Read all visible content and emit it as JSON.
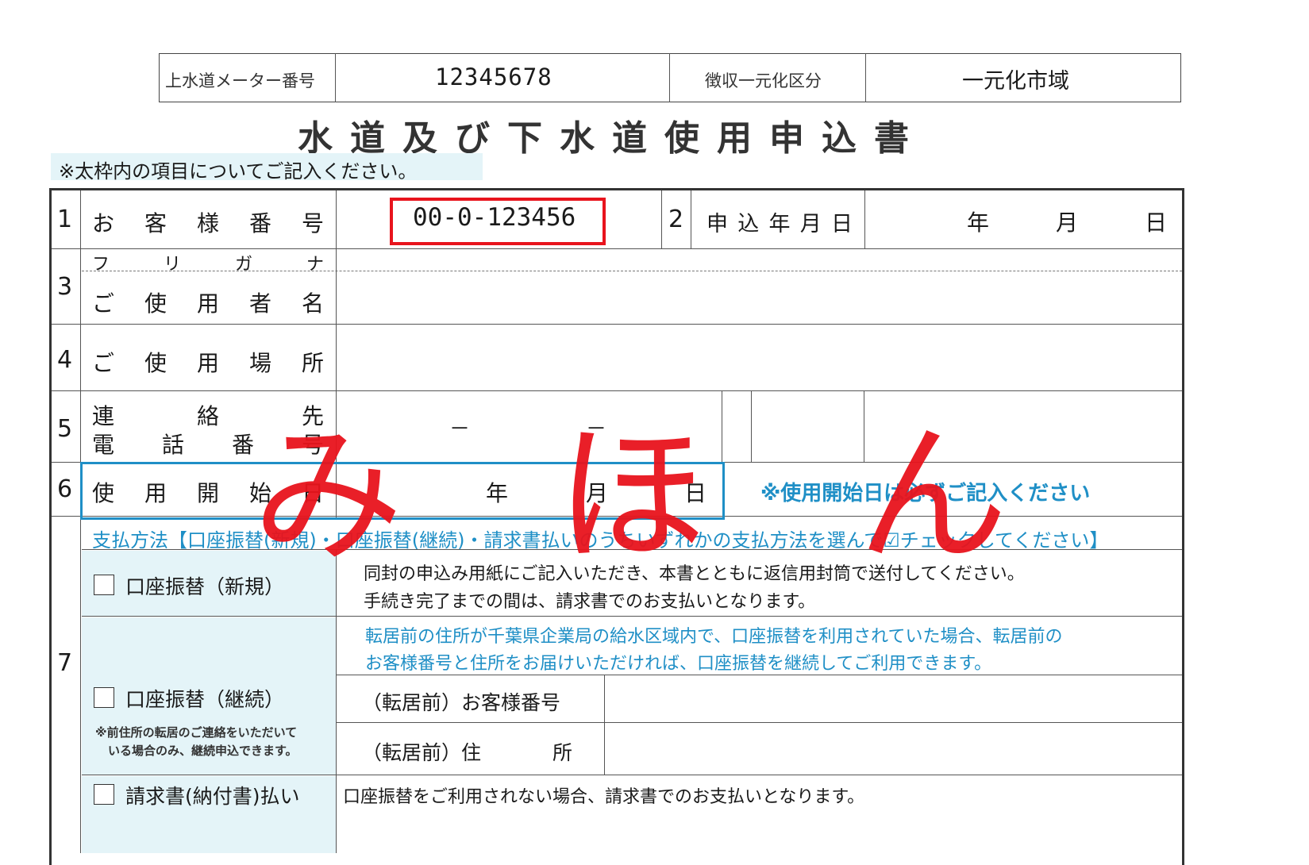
{
  "header": {
    "meter_label": "上水道メーター番号",
    "meter_value": "12345678",
    "collection_label": "徴収一元化区分",
    "collection_value": "一元化市域"
  },
  "title": "水道及び下水道使用申込書",
  "instruction": "※太枠内の項目についてご記入ください。",
  "rows": {
    "r1": {
      "num": "1",
      "label": [
        "お",
        "客",
        "様",
        "番",
        "号"
      ],
      "value": "00-0-123456"
    },
    "r2": {
      "num": "2",
      "label": [
        "申",
        "込",
        "年",
        "月",
        "日"
      ],
      "year": "年",
      "month": "月",
      "day": "日"
    },
    "r3": {
      "num": "3",
      "furigana": [
        "フ",
        "リ",
        "ガ",
        "ナ"
      ],
      "label": [
        "ご",
        "使",
        "用",
        "者",
        "名"
      ]
    },
    "r4": {
      "num": "4",
      "label": [
        "ご",
        "使",
        "用",
        "場",
        "所"
      ]
    },
    "r5": {
      "num": "5",
      "label_line1": [
        "連",
        "絡",
        "先"
      ],
      "label_line2": [
        "電",
        "話",
        "番",
        "号"
      ],
      "dash1": "－",
      "dash2": "－"
    },
    "r6": {
      "num": "6",
      "label": [
        "使",
        "用",
        "開",
        "始",
        "日"
      ],
      "year": "年",
      "month": "月",
      "day": "日",
      "note": "※使用開始日は必ずご記入ください"
    },
    "r7": {
      "num": "7",
      "payment_header": "支払方法【口座振替(新規)・口座振替(継続)・請求書払いのうちいずれかの支払方法を選んで☑チェックしてください】",
      "opt_new": {
        "label": "口座振替（新規）",
        "desc1": "同封の申込み用紙にご記入いただき、本書とともに返信用封筒で送付してください。",
        "desc2": "手続き完了までの間は、請求書でのお支払いとなります。"
      },
      "opt_continue": {
        "label": "口座振替（継続）",
        "note1": "※前住所の転居のご連絡をいただいて",
        "note2": "いる場合のみ、継続申込できます。",
        "info1": "転居前の住所が千葉県企業局の給水区域内で、口座振替を利用されていた場合、転居前の",
        "info2": "お客様番号と住所をお届けいただければ、口座振替を継続してご利用できます。",
        "prev_number_label": "（転居前）お客様番号",
        "prev_address_label1": "（転居前）住",
        "prev_address_label2": "所"
      },
      "opt_invoice": {
        "label": "請求書(納付書)払い",
        "desc": "口座振替をご利用されない場合、請求書でのお支払いとなります。"
      }
    }
  },
  "watermark": [
    "み",
    "ほ",
    "ん"
  ],
  "colors": {
    "accent_blue": "#1f8fc6",
    "stamp_red": "#e8141d",
    "highlight_cyan": "#e4f4f8"
  }
}
